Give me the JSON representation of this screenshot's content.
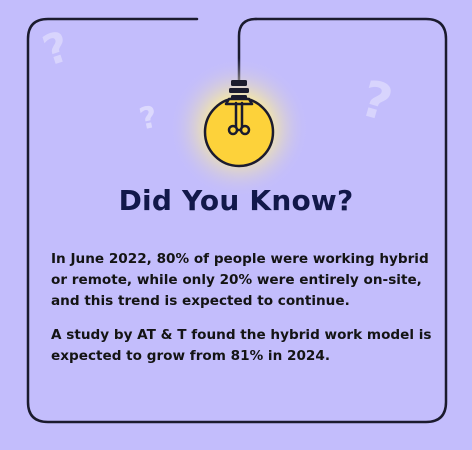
{
  "title": "Did You Know?",
  "paragraphs": [
    "In June 2022, 80% of people were working hybrid or remote, while only 20% were entirely on-site, and this trend is expected to continue.",
    "A study by AT & T found the hybrid work model is expected to grow from 81% in 2024."
  ],
  "colors": {
    "background": "#c3bdfc",
    "frame": "#1b1b2e",
    "title": "#12184a",
    "bulb": "#fdd23a",
    "glow": "#fff2a8"
  },
  "icons": {
    "bulb": "lightbulb-icon",
    "decor": "question-mark-icon"
  }
}
